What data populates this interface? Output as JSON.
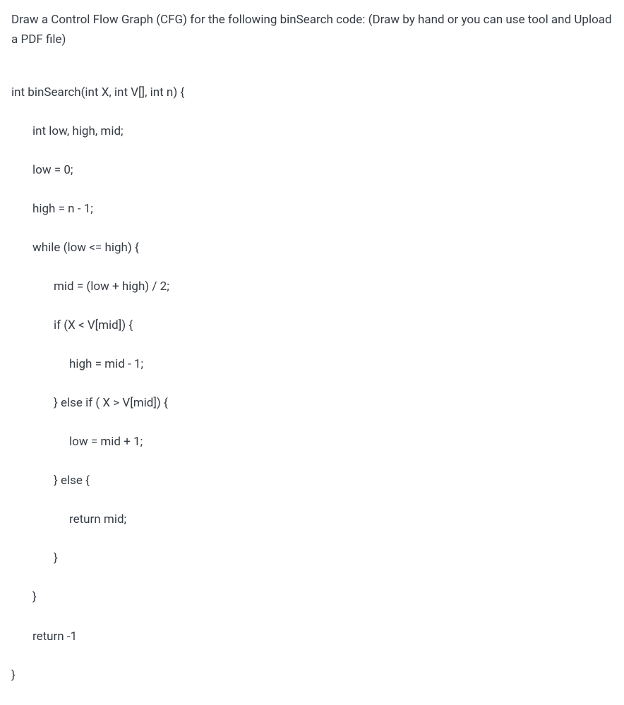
{
  "instruction": "Draw a Control Flow Graph (CFG) for the following binSearch code: (Draw by hand or you can use tool and Upload a PDF file)",
  "code": {
    "line1": "int binSearch(int X, int V[], int n) {",
    "line2": "int low, high, mid;",
    "line3": "low = 0;",
    "line4": "high = n - 1;",
    "line5": "while (low <= high) {",
    "line6": "mid = (low + high) / 2;",
    "line7": "if (X < V[mid]) {",
    "line8": "high = mid - 1;",
    "line9": "} else if ( X > V[mid]) {",
    "line10": "low = mid + 1;",
    "line11": "} else {",
    "line12": "return mid;",
    "line13": "}",
    "line14": "}",
    "line15": "return -1",
    "line16": "}"
  }
}
